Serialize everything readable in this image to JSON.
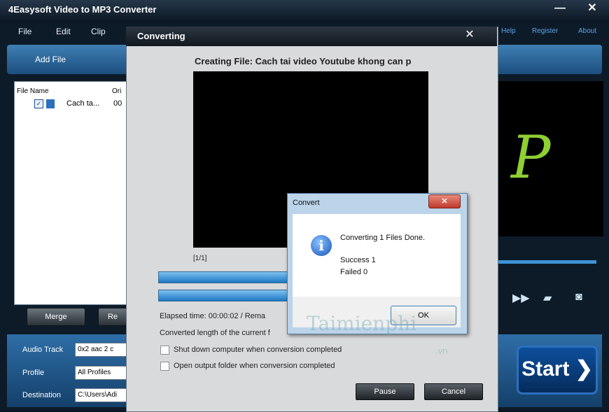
{
  "app": {
    "title": "4Easysoft Video to MP3 Converter",
    "minimize": "—",
    "close": "✕"
  },
  "menu": {
    "file": "File",
    "edit": "Edit",
    "clip": "Clip",
    "help": "Help",
    "register": "Register",
    "about": "About"
  },
  "toolbar": {
    "add_file": "Add File"
  },
  "file_list": {
    "col_name": "File Name",
    "col_orig": "Ori",
    "row_name": "Cach ta...",
    "row_dur": "00"
  },
  "controls": {
    "merge": "Merge",
    "remove": "Re"
  },
  "settings": {
    "audio_track_label": "Audio Track",
    "audio_track_value": "0x2 aac 2 c",
    "profile_label": "Profile",
    "profile_value": "All Profiles",
    "destination_label": "Destination",
    "destination_value": "C:\\Users\\Adi"
  },
  "start_label": "Start",
  "converting": {
    "title": "Converting",
    "close": "✕",
    "creating_file": "Creating File: Cach tai video Youtube khong can p",
    "counter": "[1/1]",
    "elapsed": "Elapsed time:  00:00:02 / Rema",
    "converted_length": "Converted length of the current f",
    "opt_shutdown": "Shut down computer when conversion completed",
    "opt_open_folder": "Open output folder when conversion completed",
    "pause": "Pause",
    "cancel": "Cancel"
  },
  "message_box": {
    "title": "Convert",
    "close": "✕",
    "text": "Converting 1 Files Done.",
    "success": "Success 1",
    "failed": "Failed 0",
    "ok": "OK"
  },
  "watermark": {
    "text": "Taimienphi",
    "sub": ".vn"
  },
  "colors": {
    "accent": "#1d78c5",
    "toolbar": "#3f7fb4",
    "start": "#0c4f9c"
  }
}
